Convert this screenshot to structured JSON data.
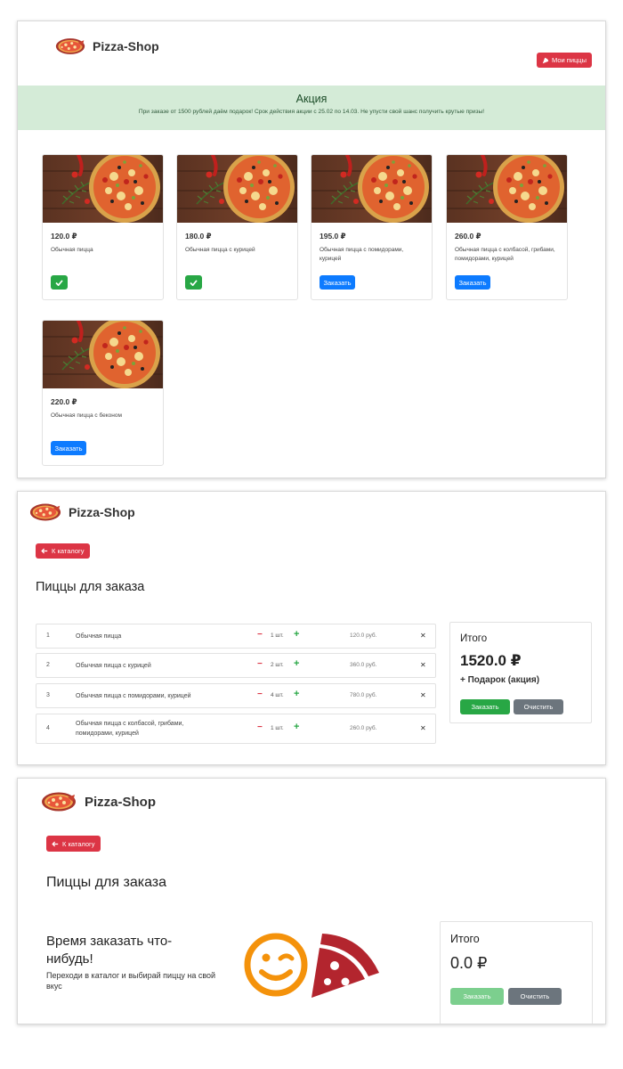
{
  "brand": {
    "name": "Pizza-Shop"
  },
  "catalog": {
    "my_pizzas_label": "Мои пиццы",
    "promo": {
      "title": "Акция",
      "text": "При заказе от 1500 рублей даём подарок! Срок действия акции с 25.02 по 14.03. Не упусти свой шанс получить крутые призы!"
    },
    "order_label": "Заказать",
    "cards": [
      {
        "price": "120.0 ₽",
        "name": "Обычная пицца",
        "in_cart": true
      },
      {
        "price": "180.0 ₽",
        "name": "Обычная пицца с курицей",
        "in_cart": true
      },
      {
        "price": "195.0 ₽",
        "name": "Обычная пицца с помидорами, курицей",
        "in_cart": false
      },
      {
        "price": "260.0 ₽",
        "name": "Обычная пицца с колбасой, грибами, помидорами, курицей",
        "in_cart": false
      },
      {
        "price": "220.0 ₽",
        "name": "Обычная пицца с беконом",
        "in_cart": false
      }
    ]
  },
  "cart": {
    "back_label": "К каталогу",
    "title": "Пиццы для заказа",
    "rows": [
      {
        "num": "1",
        "name": "Обычная пицца",
        "qty": "1 шт.",
        "price": "120.0 руб."
      },
      {
        "num": "2",
        "name": "Обычная пицца с курицей",
        "qty": "2 шт.",
        "price": "360.0 руб."
      },
      {
        "num": "3",
        "name": "Обычная пицца с помидорами, курицей",
        "qty": "4 шт.",
        "price": "780.0 руб."
      },
      {
        "num": "4",
        "name": "Обычная пицца с колбасой, грибами, помидорами, курицей",
        "qty": "1 шт.",
        "price": "260.0 руб."
      }
    ],
    "summary": {
      "title": "Итого",
      "total": "1520.0 ₽",
      "gift": "+ Подарок (акция)",
      "order_label": "Заказать",
      "clear_label": "Очистить"
    }
  },
  "empty_cart": {
    "back_label": "К каталогу",
    "title": "Пиццы для заказа",
    "message_title": "Время заказать что-нибудь!",
    "message_text": "Переходи в каталог и выбирай пиццу на свой вкус",
    "summary": {
      "title": "Итого",
      "total": "0.0 ₽",
      "order_label": "Заказать",
      "clear_label": "Очистить"
    }
  },
  "icons": {
    "logo": "pizza-logo-icon",
    "my_pizzas": "pizza-slice-icon",
    "in_cart": "check-icon",
    "back": "arrow-left-icon",
    "minus": "minus-icon",
    "plus": "plus-icon",
    "remove": "close-icon",
    "wink": "wink-face-icon",
    "slice": "pizza-slice-icon"
  },
  "colors": {
    "primary": "#0d7bff",
    "danger": "#dc3545",
    "success": "#28a745",
    "secondary": "#6c757d",
    "promo_bg": "#d4ebd7",
    "wink_orange": "#f4920b",
    "slice_red": "#b3252e"
  }
}
